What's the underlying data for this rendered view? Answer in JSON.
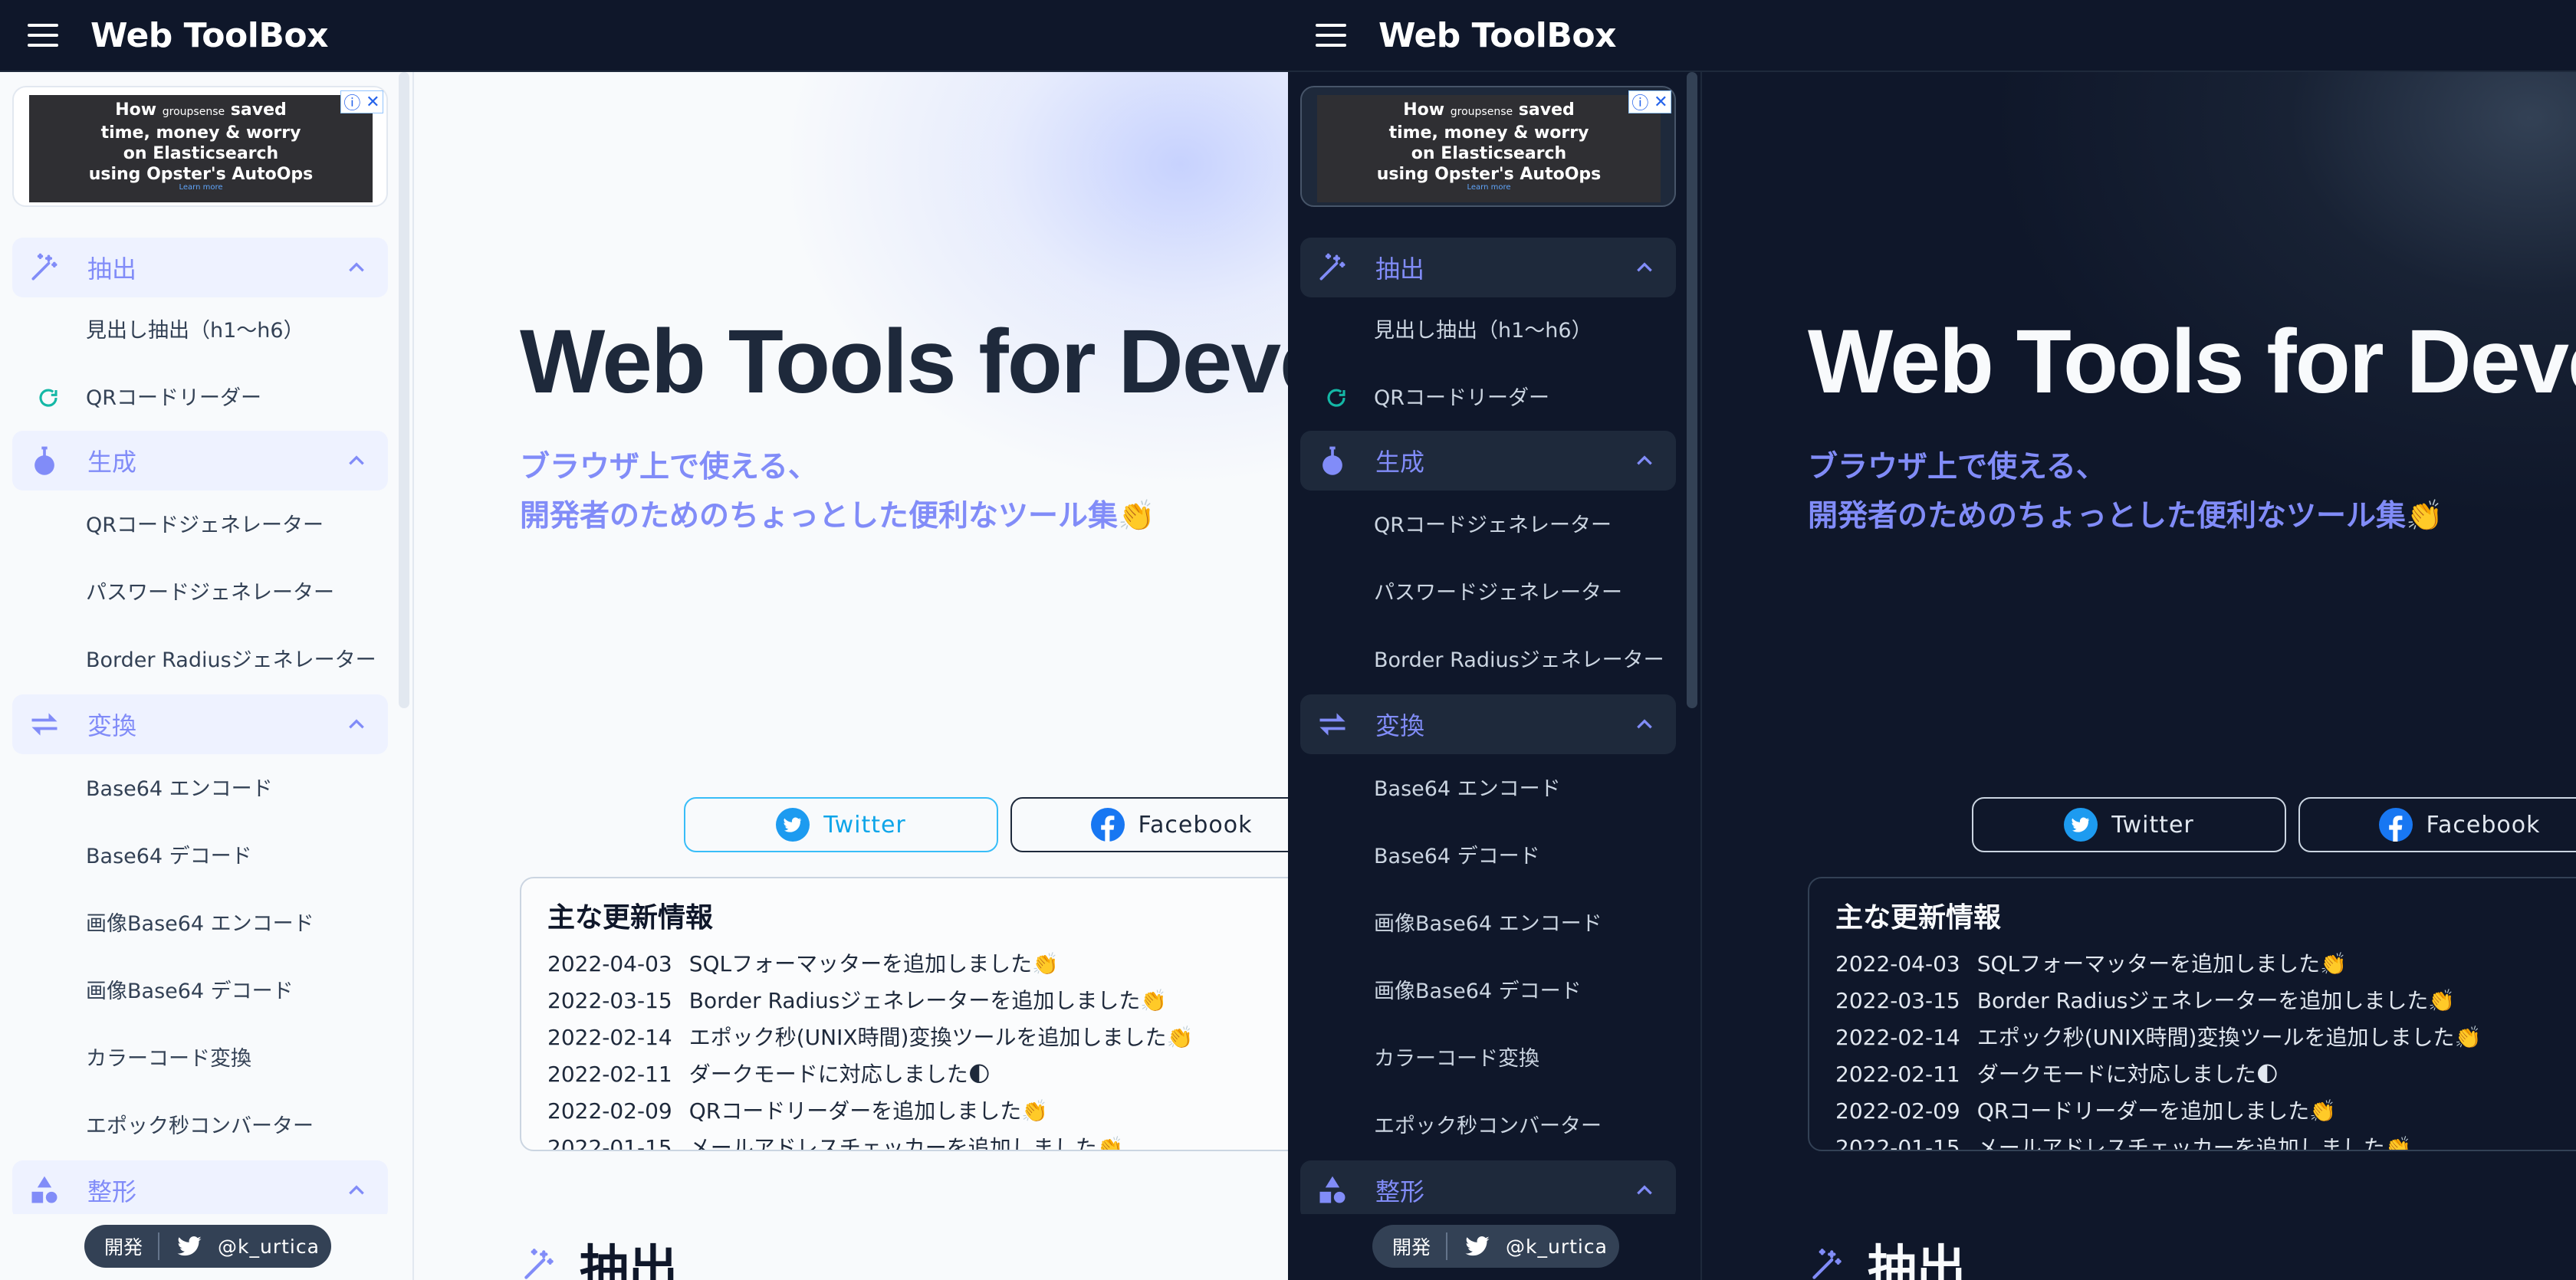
{
  "app": {
    "title": "Web ToolBox"
  },
  "ad": {
    "text_line1": "How",
    "brand": "groupsense",
    "text_line1b": "saved",
    "text_line2": "time, money & worry",
    "text_line3": "on Elasticsearch",
    "text_line4": "using Opster's AutoOps",
    "cta": "Learn more"
  },
  "sidebar": {
    "sections": [
      {
        "label": "抽出",
        "icon": "magic-wand-icon",
        "items": [
          "見出し抽出（h1〜h6）",
          "QRコードリーダー"
        ]
      },
      {
        "label": "生成",
        "icon": "flask-icon",
        "items": [
          "QRコードジェネレーター",
          "パスワードジェネレーター",
          "Border Radiusジェネレーター"
        ]
      },
      {
        "label": "変換",
        "icon": "swap-arrows-icon",
        "items": [
          "Base64 エンコード",
          "Base64 デコード",
          "画像Base64 エンコード",
          "画像Base64 デコード",
          "カラーコード変換",
          "エポック秒コンバーター"
        ]
      },
      {
        "label": "整形",
        "icon": "shapes-icon",
        "items": []
      }
    ]
  },
  "developer": {
    "label": "開発",
    "handle": "@k_urtica"
  },
  "hero": {
    "title": "Web Tools for Deve",
    "subtitle_line1": "ブラウザ上で使える、",
    "subtitle_line2": "開発者のためのちょっとした便利なツール集👏"
  },
  "share": {
    "twitter": "Twitter",
    "facebook": "Facebook"
  },
  "updates": {
    "title": "主な更新情報",
    "entries": [
      {
        "date": "2022-04-03",
        "text": "SQLフォーマッターを追加しました👏"
      },
      {
        "date": "2022-03-15",
        "text": "Border Radiusジェネレーターを追加しました👏"
      },
      {
        "date": "2022-02-14",
        "text": "エポック秒(UNIX時間)変換ツールを追加しました👏"
      },
      {
        "date": "2022-02-11",
        "text": "ダークモードに対応しました🌓"
      },
      {
        "date": "2022-02-09",
        "text": "QRコードリーダーを追加しました👏"
      },
      {
        "date": "2022-01-15",
        "text": "メールアドレスチェッカーを追加しました👏"
      }
    ]
  },
  "section_heading": "抽出",
  "colors": {
    "accent": "#818cf8",
    "navbar": "#0f172a",
    "teal": "#14b8a6",
    "twitter": "#1d9bf0",
    "facebook": "#1877f2"
  }
}
